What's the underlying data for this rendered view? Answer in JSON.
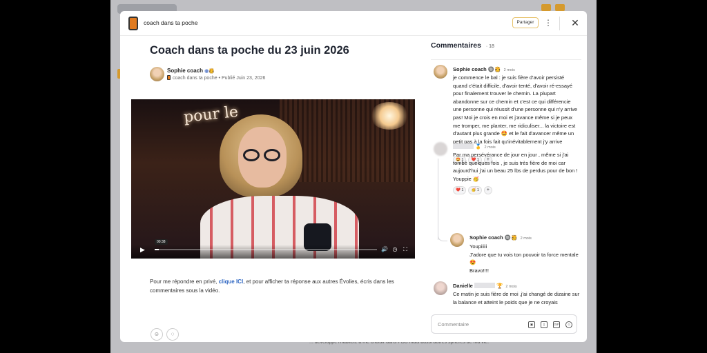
{
  "app": {
    "title": "coach dans ta poche"
  },
  "toolbar": {
    "share_label": "Partager",
    "more_icon": "more-vertical-icon",
    "close_icon": "close-icon"
  },
  "post": {
    "title": "Coach dans ta poche du 23 juin 2026",
    "author": "Sophie coach",
    "meta": "coach dans ta poche • Publié Juin 23, 2026",
    "video": {
      "neon_text": "pour le",
      "timestamp": "00:38",
      "progress": 0.02
    },
    "body_before": "Pour me répondre en privé, ",
    "body_link": "clique ICI",
    "body_after": ", et pour afficher ta réponse aux autres Évolies, écris dans les commentaires sous la vidéo."
  },
  "comments": {
    "header": "Commentaires",
    "count": "18",
    "input_placeholder": "Commentaire",
    "items": [
      {
        "author": "Sophie coach",
        "ago": "2 mois",
        "badges": "🔘🫅",
        "text": "je commence le bal : je suis fière d'avoir persisté quand c'était difficile, d'avoir tenté, d'avoir ré-essayé pour finalement trouver le chemin. La plupart abandonne sur ce chemin et c'est ce qui différencie une personne qui réussit d'une personne qui n'y arrive pas! Moi je crois en moi et j'avance même si je peux me tromper, me planter, me ridiculiser... la victoire est d'autant plus grande 🤩 et le fait d'avancer même un petit pas à la fois fait qu'inévitablement j'y arrive",
        "reactions": [
          "🤩 1",
          "❤️ 1"
        ]
      },
      {
        "author": "",
        "ago": "2 mois",
        "badges": "🥇",
        "text": "Par ma persévérance de jour en jour , même si j'ai tombé quelques fois , je suis très fière de moi car aujourd'hui j'ai un beau 25 lbs de perdus pour de bon ! Youppie 🥳",
        "reactions": [
          "❤️ 1",
          "🥳 1"
        ]
      },
      {
        "author": "Sophie coach",
        "ago": "2 mois",
        "badges": "🔘🫅",
        "text": "Youpiiiii\nJ'adore que tu vois ton pouvoir ta force mentale 😍\nBravo!!!!"
      },
      {
        "author": "Danielle",
        "ago": "2 mois",
        "badges": "🏆",
        "text": "Ce matin je suis fière de moi ,j'ai changé de dizaine sur la balance et atteint le poids que je ne croyais"
      }
    ]
  },
  "page_bg_text": "... développe l'habileté à me choisir dans PDB mais aussi autres sphères de ma vie."
}
